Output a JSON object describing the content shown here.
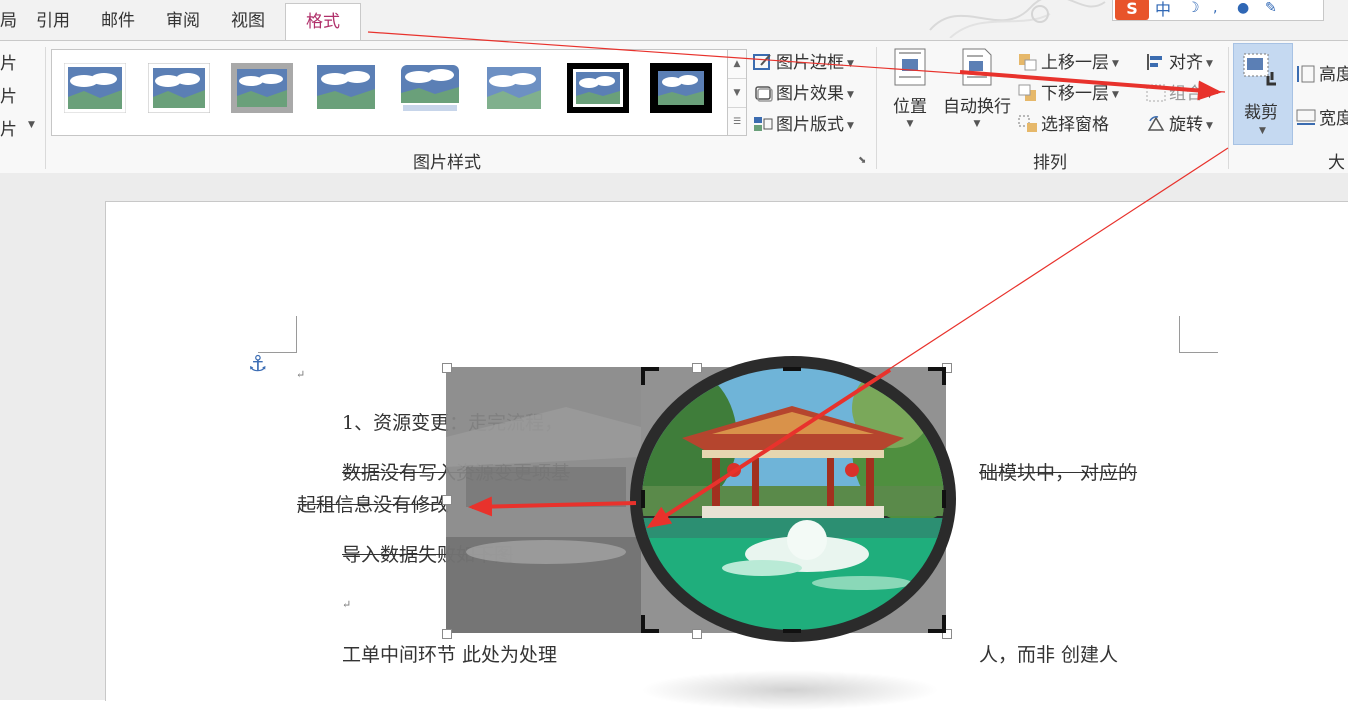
{
  "tabs": [
    {
      "label": "局"
    },
    {
      "label": "引用"
    },
    {
      "label": "邮件"
    },
    {
      "label": "审阅"
    },
    {
      "label": "视图"
    },
    {
      "label": "格式",
      "active": true
    }
  ],
  "ime_bar": {
    "logo": "S",
    "text": "中"
  },
  "ribbon": {
    "left_column": [
      "片",
      "片",
      "片"
    ],
    "picture_styles": {
      "group_label": "图片样式",
      "commands": {
        "border": "图片边框",
        "effects": "图片效果",
        "layout": "图片版式"
      }
    },
    "arrange": {
      "group_label": "排列",
      "position": "位置",
      "wrap_text": "自动换行",
      "bring_forward": "上移一层",
      "send_backward": "下移一层",
      "selection_pane": "选择窗格",
      "align": "对齐",
      "group": "组合",
      "rotate": "旋转"
    },
    "size": {
      "group_label": "大",
      "crop": "裁剪",
      "height": "高度",
      "width": "宽度"
    }
  },
  "document": {
    "para1": "1、资源变更：走完流程，",
    "para2_left": "数据没有写入资源变更项基",
    "para2_right": "础模块中，  对应的",
    "para3": "起租信息没有修改",
    "para4": "导入数据失败如下图",
    "para6_left": "工单中间环节  此处为处理",
    "para6_right": "人，而非  创建人",
    "mark": "↵"
  },
  "colors": {
    "active_tab": "#b0306a",
    "crop_highlight": "#c5d9f1",
    "arrow": "#e8322c"
  }
}
